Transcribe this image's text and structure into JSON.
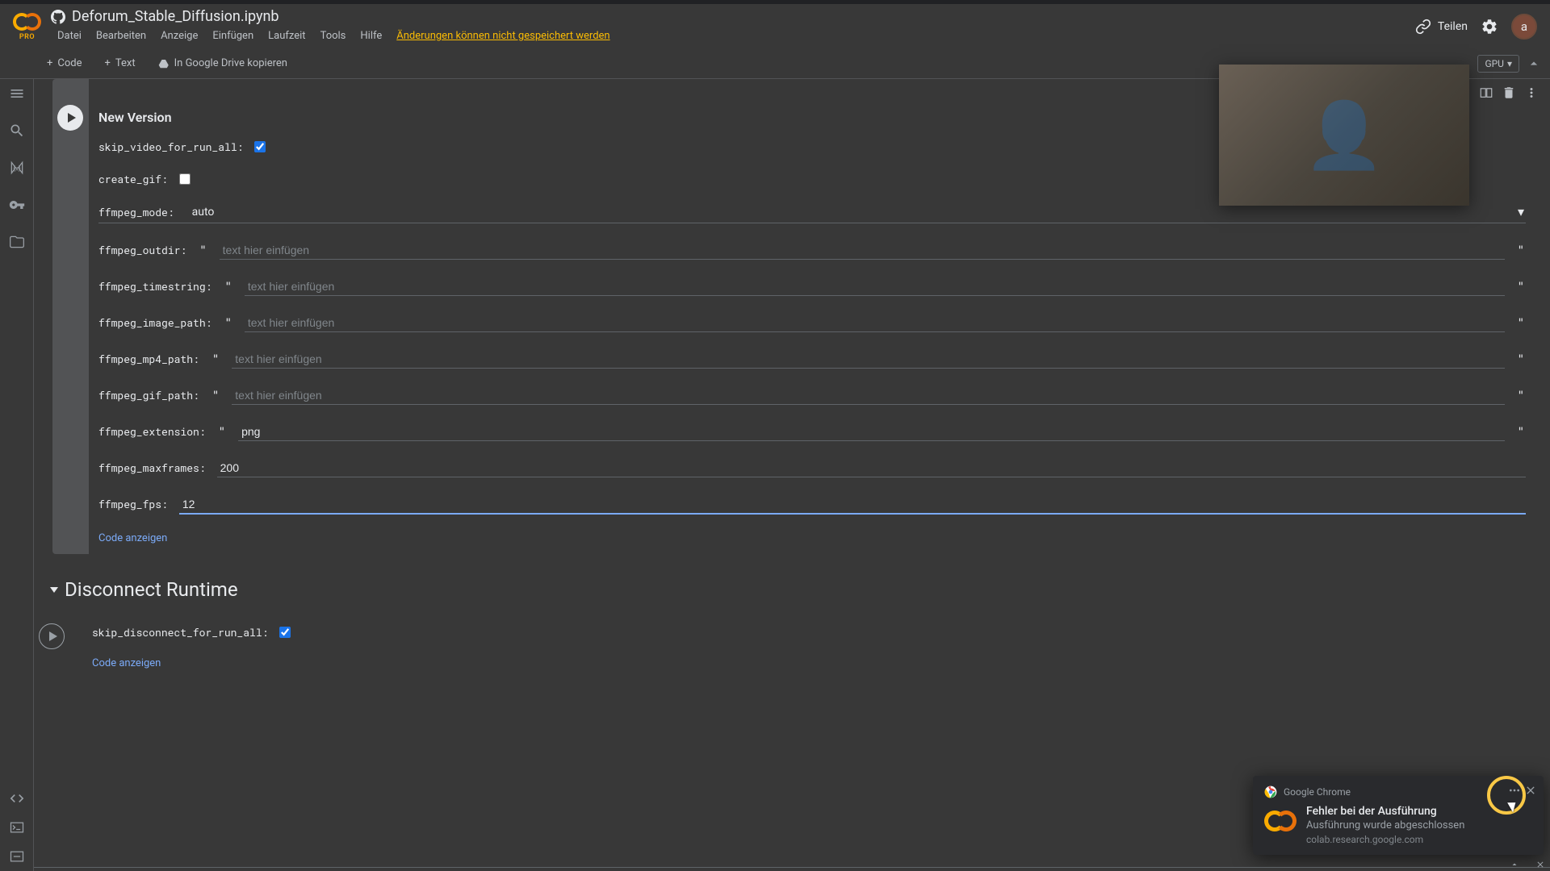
{
  "header": {
    "pro": "PRO",
    "title": "Deforum_Stable_Diffusion.ipynb",
    "menus": [
      "Datei",
      "Bearbeiten",
      "Anzeige",
      "Einfügen",
      "Laufzeit",
      "Tools",
      "Hilfe"
    ],
    "save_warning": "Änderungen können nicht gespeichert werden",
    "share": "Teilen",
    "avatar_letter": "a"
  },
  "toolbar": {
    "code": "Code",
    "text": "Text",
    "copy_drive": "In Google Drive kopieren",
    "runtime_type": "GPU"
  },
  "cell1": {
    "title": "New Version",
    "fields": {
      "skip_video_label": "skip_video_for_run_all:",
      "create_gif_label": "create_gif:",
      "ffmpeg_mode_label": "ffmpeg_mode:",
      "ffmpeg_mode_value": "auto",
      "ffmpeg_outdir_label": "ffmpeg_outdir:",
      "ffmpeg_timestring_label": "ffmpeg_timestring:",
      "ffmpeg_image_path_label": "ffmpeg_image_path:",
      "ffmpeg_mp4_path_label": "ffmpeg_mp4_path:",
      "ffmpeg_gif_path_label": "ffmpeg_gif_path:",
      "ffmpeg_extension_label": "ffmpeg_extension:",
      "ffmpeg_extension_value": "png",
      "ffmpeg_maxframes_label": "ffmpeg_maxframes:",
      "ffmpeg_maxframes_value": "200",
      "ffmpeg_fps_label": "ffmpeg_fps:",
      "ffmpeg_fps_value": "12",
      "placeholder": "text hier einfügen"
    },
    "show_code": "Code anzeigen"
  },
  "section2": {
    "title": "Disconnect Runtime"
  },
  "cell2": {
    "skip_disconnect_label": "skip_disconnect_for_run_all:",
    "show_code": "Code anzeigen"
  },
  "notification": {
    "app": "Google Chrome",
    "title": "Fehler bei der Ausführung",
    "message": "Ausführung wurde abgeschlossen",
    "url": "colab.research.google.com"
  }
}
